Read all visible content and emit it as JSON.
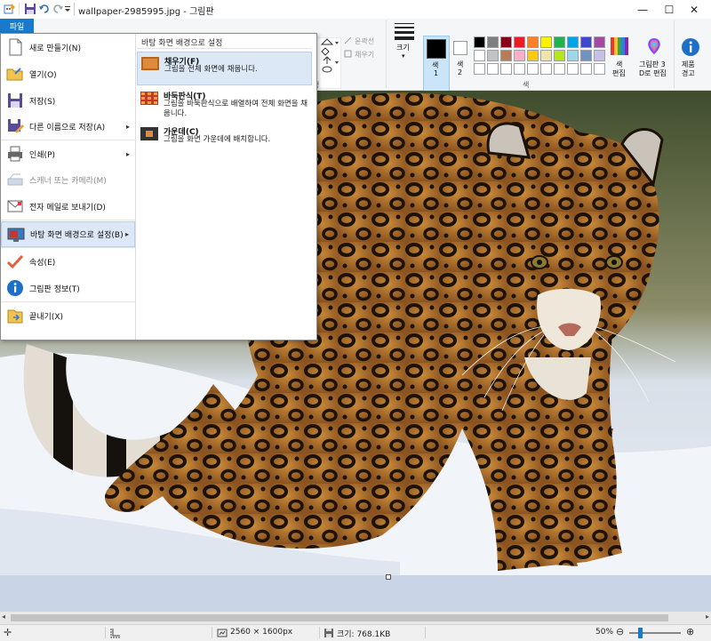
{
  "titlebar": {
    "title": "wallpaper-2985995.jpg - 그림판",
    "minimize": "—",
    "maximize": "☐",
    "close": "✕"
  },
  "ribbon": {
    "file_tab": "파일",
    "shapes_outline": "윤곽선",
    "shapes_fill": "채우기",
    "size_label": "크기",
    "color1_label": "색",
    "color1_num": "1",
    "color2_label": "색",
    "color2_num": "2",
    "edit_colors_line1": "색",
    "edit_colors_line2": "편집",
    "paint3d_line1": "그림판 3",
    "paint3d_line2": "D로 편집",
    "product_alert_line1": "제품",
    "product_alert_line2": "경고",
    "colors_group_label": "색",
    "shapes_group_suffix": "형",
    "color1_value": "#000000",
    "color2_value": "#ffffff",
    "palette_row1": [
      "#000000",
      "#7f7f7f",
      "#880015",
      "#ed1c24",
      "#ff7f27",
      "#fff200",
      "#22b14c",
      "#00a2e8",
      "#3f48cc",
      "#a349a4"
    ],
    "palette_row2": [
      "#ffffff",
      "#c3c3c3",
      "#b97a57",
      "#ffaec9",
      "#ffc90e",
      "#efe4b0",
      "#b5e61d",
      "#99d9ea",
      "#7092be",
      "#c8bfe7"
    ],
    "accent": "#1979ca"
  },
  "file_menu": {
    "items": [
      {
        "label": "새로 만들기(N)",
        "icon": "new-file-icon"
      },
      {
        "label": "열기(O)",
        "icon": "open-folder-icon"
      },
      {
        "label": "저장(S)",
        "icon": "save-icon"
      },
      {
        "label": "다른 이름으로 저장(A)",
        "icon": "save-as-icon"
      },
      {
        "label": "인쇄(P)",
        "icon": "printer-icon"
      },
      {
        "label": "스캐너 또는 카메라(M)",
        "icon": "scanner-icon"
      },
      {
        "label": "전자 메일로 보내기(D)",
        "icon": "email-icon"
      },
      {
        "label": "바탕 화면 배경으로 설정(B)",
        "icon": "desktop-background-icon"
      },
      {
        "label": "속성(E)",
        "icon": "checkmark-icon"
      },
      {
        "label": "그림판 정보(T)",
        "icon": "info-icon"
      },
      {
        "label": "끝내기(X)",
        "icon": "exit-icon"
      }
    ],
    "submenu_header": "바탕 화면 배경으로 설정",
    "submenu": [
      {
        "title": "채우기(F)",
        "desc": "그림을 전체 화면에 채웁니다."
      },
      {
        "title": "바둑판식(T)",
        "desc": "그림을 바둑판식으로 배열하여 전체 화면을 채웁니다."
      },
      {
        "title": "가운데(C)",
        "desc": "그림을 화면 가운데에 배치합니다."
      }
    ]
  },
  "status": {
    "dimensions": "2560 × 1600px",
    "filesize": "크기: 768.1KB",
    "zoom": "50%",
    "zoom_fraction": 0.5
  }
}
